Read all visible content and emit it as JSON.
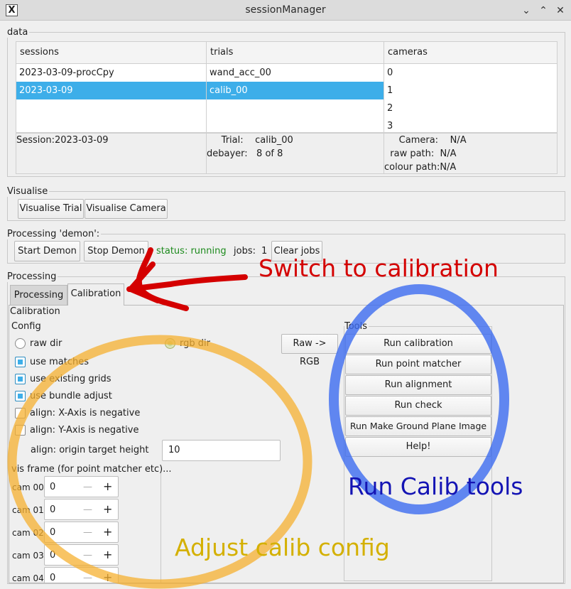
{
  "window": {
    "title": "sessionManager",
    "icon": "x-app-icon",
    "controls": [
      "∨",
      "∧",
      "✕"
    ]
  },
  "data_group": {
    "label": "data",
    "headers": [
      "sessions",
      "trials",
      "cameras"
    ],
    "sessions": [
      "2023-03-09-procCpy",
      "2023-03-09"
    ],
    "trials": [
      "wand_acc_00",
      "calib_00"
    ],
    "cameras": [
      "0",
      "1",
      "2",
      "3"
    ],
    "selected_session": "2023-03-09",
    "selected_trial": "calib_00",
    "session_info": "Session:2023-03-09",
    "trial_info": "     Trial:    calib_00\ndebayer:   8 of 8",
    "camera_info": "     Camera:    N/A\n  raw path:  N/A\ncolour path:N/A"
  },
  "visualise": {
    "label": "Visualise",
    "trial_button": "Visualise Trial",
    "camera_button": "Visualise Camera"
  },
  "demon": {
    "label": "Processing 'demon':",
    "start_button": "Start Demon",
    "stop_button": "Stop Demon",
    "status": "status: running",
    "status_color": "#1c8a1c",
    "jobs_label": "jobs:",
    "jobs_count": "1",
    "clear_button": "Clear jobs"
  },
  "processing": {
    "label": "Processing",
    "tabs": [
      "Processing",
      "Calibration"
    ],
    "active_tab": "Calibration",
    "calibration_label": "Calibration",
    "config": {
      "label": "Config",
      "raw_dir": "raw dir",
      "rgb_dir": "rgb dir",
      "raw_to_rgb": "Raw -> RGB",
      "use_matches": "use matches",
      "use_existing_grids": "use existing grids",
      "use_bundle_adjust": "use bundle adjust",
      "align_x_neg": "align: X-Axis is negative",
      "align_y_neg": "align: Y-Axis is negative",
      "origin_height_label": "align: origin target height",
      "origin_height_value": "10",
      "vis_frame_label": "vis frame (for point matcher etc)...",
      "cams": [
        {
          "label": "cam 00",
          "value": "0"
        },
        {
          "label": "cam 01",
          "value": "0"
        },
        {
          "label": "cam 02",
          "value": "0"
        },
        {
          "label": "cam 03",
          "value": "0"
        },
        {
          "label": "cam 04",
          "value": "0"
        }
      ],
      "minus": "—",
      "plus": "+"
    },
    "tools": {
      "label": "Tools",
      "buttons": [
        "Run calibration",
        "Run point matcher",
        "Run alignment",
        "Run check",
        "Run Make Ground Plane Image",
        "Help!"
      ]
    }
  },
  "annotations": {
    "switch": "Switch to calibration",
    "switch_color": "#d40000",
    "run_tools": "Run Calib tools",
    "run_tools_color": "#1414b4",
    "adjust": "Adjust calib config",
    "adjust_color": "#d4b000",
    "blue_circle_color": "#3c6cf0",
    "orange_circle_color": "#f5b030"
  }
}
